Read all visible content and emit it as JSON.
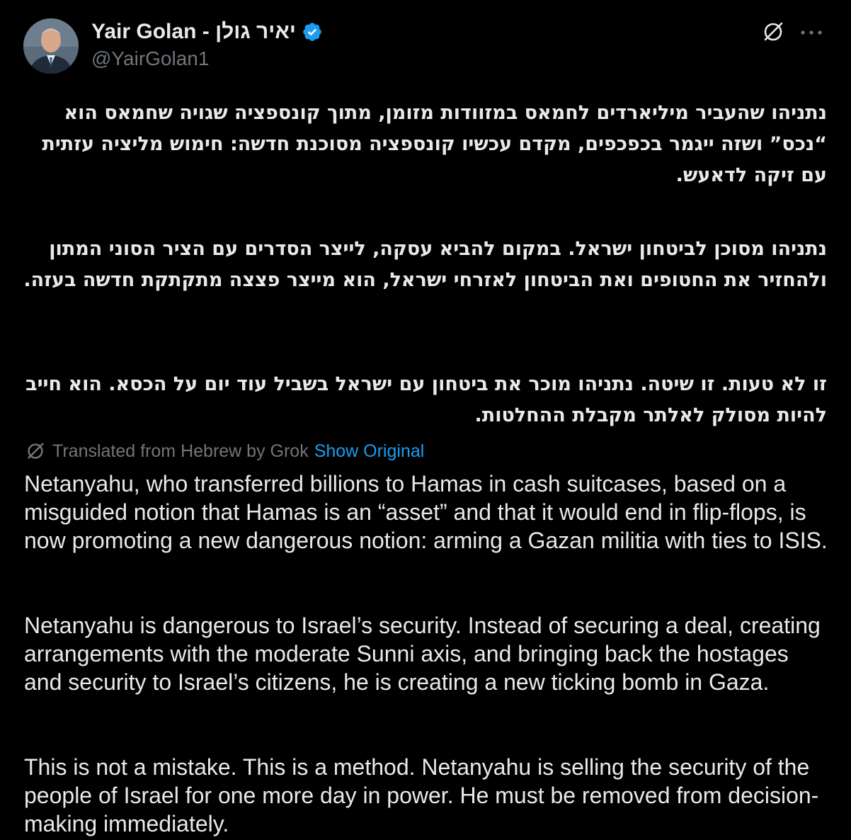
{
  "author": {
    "display_name": "Yair Golan - יאיר גולן",
    "handle": "@YairGolan1",
    "verified": true,
    "avatar_icon": "person-portrait-avatar"
  },
  "icons": {
    "verified": "verified-badge-icon",
    "grok": "grok-icon",
    "more": "more-options-icon",
    "translate": "grok-translate-icon"
  },
  "colors": {
    "background": "#000000",
    "text_primary": "#e7e9ea",
    "text_secondary": "#71767b",
    "accent": "#1d9bf0"
  },
  "hebrew_text": {
    "paragraph_1": "נתניהו שהעביר מיליארדים לחמאס במזוודות מזומן, מתוך קונספציה שגויה שחמאס הוא “נכס” ושזה ייגמר בכפכפים, מקדם עכשיו קונספציה מסוכנת חדשה: חימוש מליציה עזתית עם זיקה לדאעש.",
    "paragraph_2": "נתניהו מסוכן לביטחון ישראל. במקום להביא עסקה, לייצר הסדרים עם הציר הסוני המתון ולהחזיר את החטופים ואת הביטחון לאזרחי ישראל, הוא מייצר פצצה מתקתקת חדשה בעזה.",
    "paragraph_3": "זו לא טעות. זו שיטה. נתניהו מוכר את ביטחון עם ישראל בשביל עוד יום על הכסא. הוא חייב להיות מסולק לאלתר מקבלת ההחלטות."
  },
  "translation": {
    "label": "Translated from Hebrew by Grok",
    "show_original": "Show Original"
  },
  "english_text": {
    "paragraph_1": "Netanyahu, who transferred billions to Hamas in cash suitcases, based on a misguided notion that Hamas is an “asset” and that it would end in flip-flops, is now promoting a new dangerous notion: arming a Gazan militia with ties to ISIS.",
    "paragraph_2": "Netanyahu is dangerous to Israel’s security. Instead of securing a deal, creating arrangements with the moderate Sunni axis, and bringing back the hostages and security to Israel’s citizens, he is creating a new ticking bomb in Gaza.",
    "paragraph_3": "This is not a mistake. This is a method. Netanyahu is selling the security of the people of Israel for one more day in power. He must be removed from decision-making immediately."
  }
}
